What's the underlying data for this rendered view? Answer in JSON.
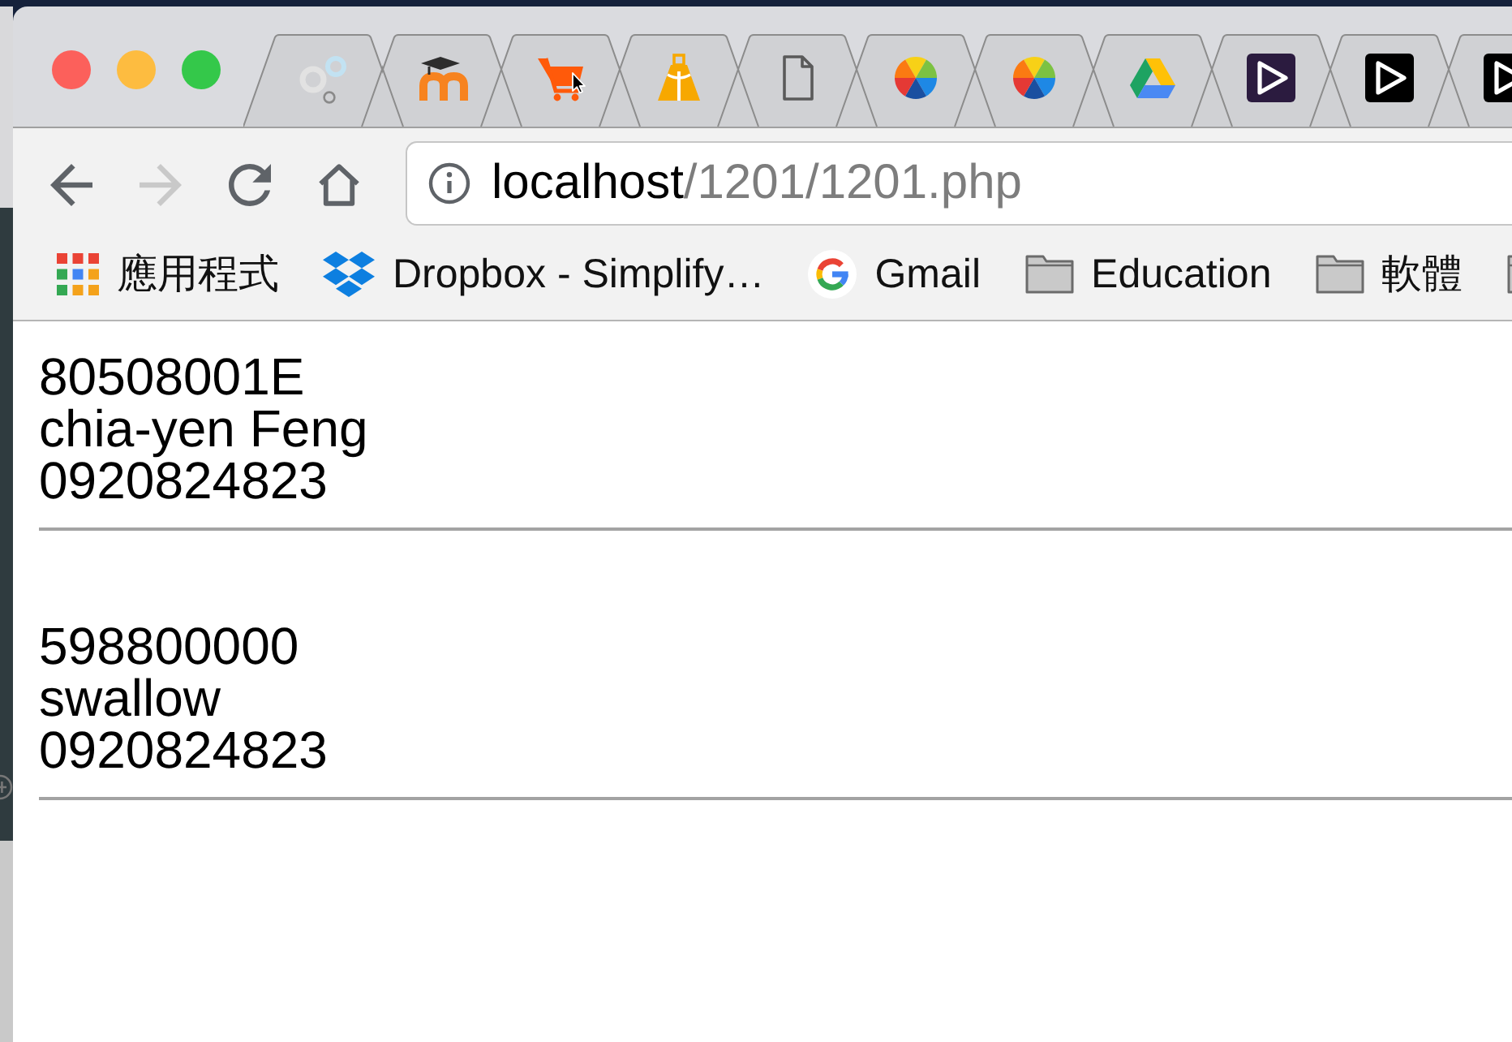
{
  "window": {
    "controls": [
      {
        "color": "#fc605b"
      },
      {
        "color": "#fdbc40"
      },
      {
        "color": "#34c84a"
      }
    ]
  },
  "tabs": [
    {
      "kind": "rings",
      "selected": false
    },
    {
      "kind": "cap",
      "selected": false
    },
    {
      "kind": "cart",
      "selected": false
    },
    {
      "kind": "bag",
      "selected": false
    },
    {
      "kind": "page",
      "selected": false
    },
    {
      "kind": "wheel",
      "selected": false
    },
    {
      "kind": "wheel",
      "selected": false
    },
    {
      "kind": "triangle",
      "selected": false
    },
    {
      "kind": "playpurple",
      "selected": false
    },
    {
      "kind": "playblack",
      "selected": false
    },
    {
      "kind": "playblack",
      "selected": false
    }
  ],
  "nav_buttons": [
    {
      "kind": "back",
      "disabled": false
    },
    {
      "kind": "forward",
      "disabled": true
    },
    {
      "kind": "reload",
      "disabled": false
    },
    {
      "kind": "home",
      "disabled": false
    }
  ],
  "address_bar": {
    "host": "localhost",
    "path": "/1201/1201.php"
  },
  "bookmarks": [
    {
      "kind": "apps",
      "label": "應用程式"
    },
    {
      "kind": "boxes",
      "label": "Dropbox - Simplify…"
    },
    {
      "kind": "g",
      "label": "Gmail"
    },
    {
      "kind": "folder",
      "label": "Education"
    },
    {
      "kind": "folder",
      "label": "軟體"
    },
    {
      "kind": "folder"
    }
  ],
  "records": [
    {
      "code": "80508001E",
      "name": "chia-yen Feng",
      "phone": "0920824823"
    },
    {
      "code": "598800000",
      "name": "swallow",
      "phone": "0920824823"
    }
  ]
}
